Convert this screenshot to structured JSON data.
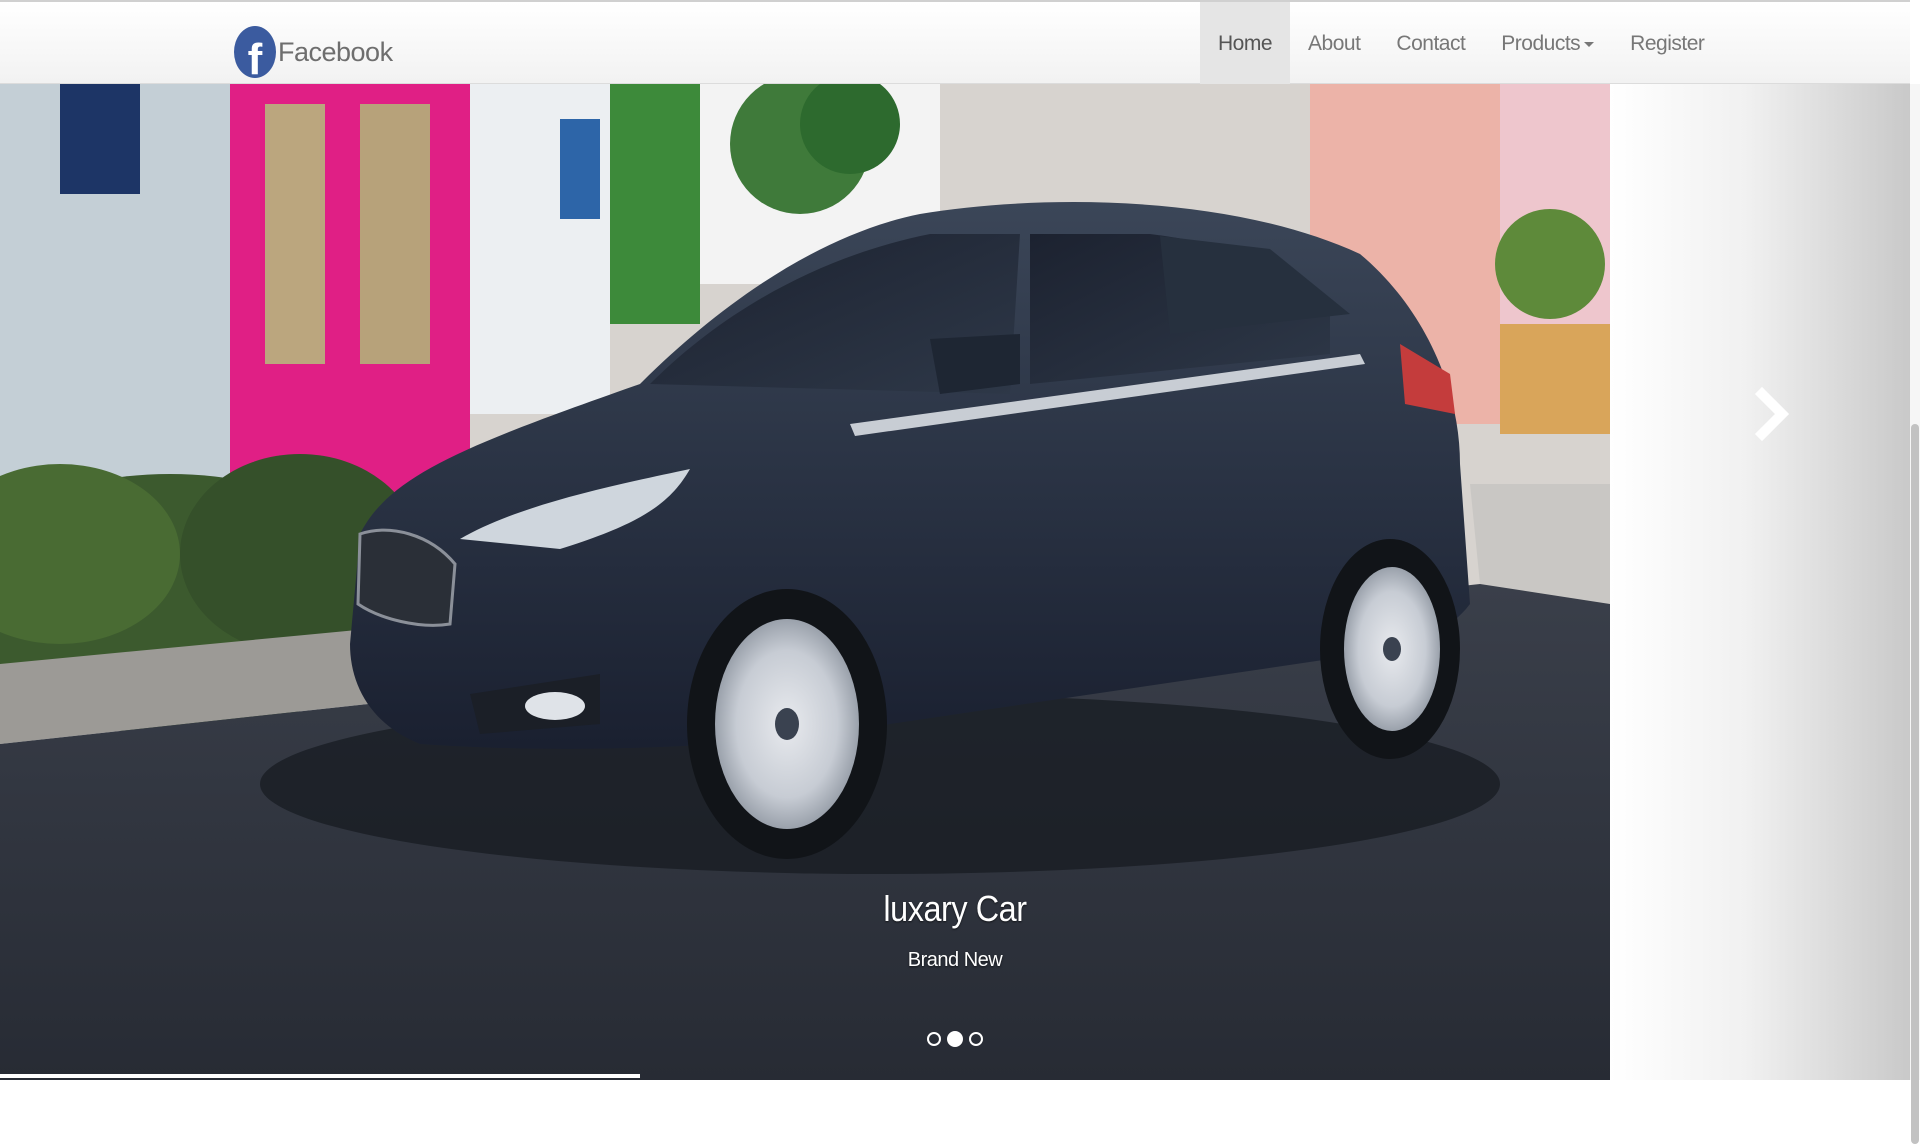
{
  "brand": {
    "icon": "facebook-f-icon",
    "logo_letter": "f",
    "label": "Facebook",
    "logo_color": "#3b5b9f"
  },
  "nav": {
    "items": [
      {
        "label": "Home",
        "active": true
      },
      {
        "label": "About",
        "active": false
      },
      {
        "label": "Contact",
        "active": false
      },
      {
        "label": "Products",
        "active": false,
        "dropdown": true
      },
      {
        "label": "Register",
        "active": false
      }
    ]
  },
  "carousel": {
    "slide_image": "dark-blue-hatchback-car-photo",
    "caption_title": "luxary Car",
    "caption_subtitle": "Brand New",
    "next_icon": "chevron-right-icon",
    "indicators": 3,
    "active_indicator": 2
  }
}
